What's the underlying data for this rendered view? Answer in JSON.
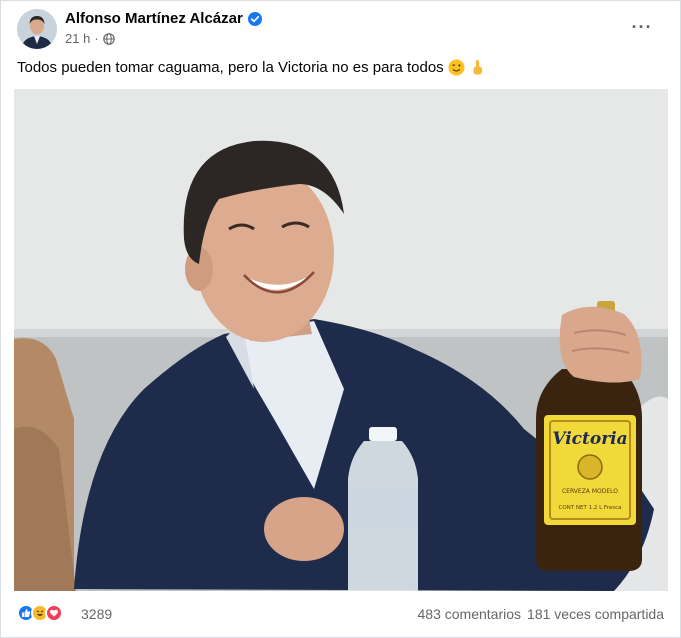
{
  "post": {
    "author": "Alfonso Martínez Alcázar",
    "time": "21 h",
    "separator": "·",
    "text": "Todos pueden tomar caguama, pero la Victoria no es para todos",
    "more_label": "···"
  },
  "reactions": {
    "count": "3289",
    "comments": "483 comentarios",
    "shares": "181 veces compartida"
  },
  "bottle": {
    "brand": "Victoria",
    "sub": "CERVEZA MODELO",
    "content": "CONT NET 1.2 L Fresca"
  },
  "colors": {
    "like": "#1877f2",
    "haha": "#f7b928",
    "love": "#f33e58",
    "verified": "#1877f2"
  }
}
